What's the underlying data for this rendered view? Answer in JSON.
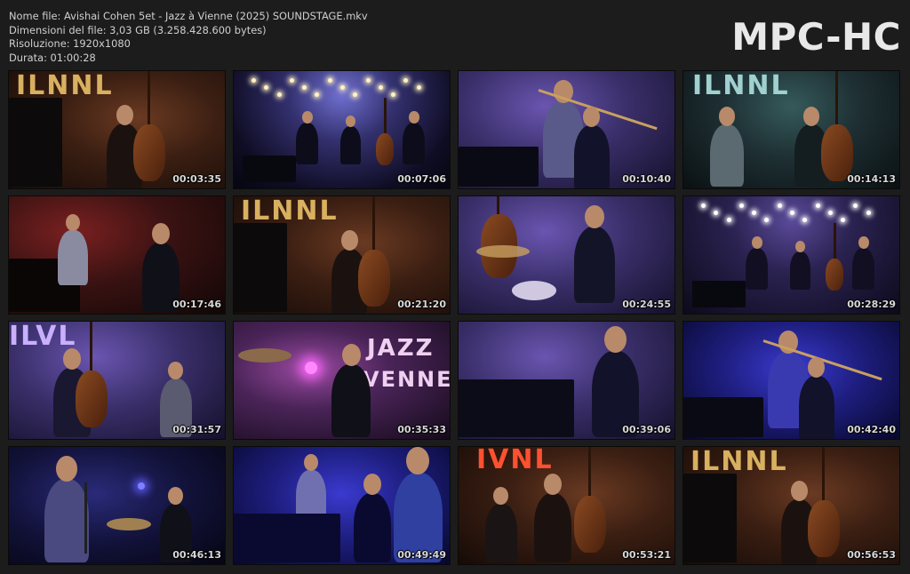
{
  "file_info": {
    "name_line": "Nome file: Avishai Cohen 5et - Jazz à Vienne (2025) SOUNDSTAGE.mkv",
    "size_line": "Dimensioni del file: 3,03 GB (3.258.428.600 bytes)",
    "resolution_line": "Risoluzione: 1920x1080",
    "duration_line": "Durata: 01:00:28"
  },
  "logo": "MPC-HC",
  "thumbnails": [
    {
      "timestamp": "00:03:35",
      "scene": "bass-solo",
      "palette": "amber"
    },
    {
      "timestamp": "00:07:06",
      "scene": "wide-stage",
      "palette": "blue-stage"
    },
    {
      "timestamp": "00:10:40",
      "scene": "trombone-piano",
      "palette": "violet"
    },
    {
      "timestamp": "00:14:13",
      "scene": "trombone-bass",
      "palette": "teal"
    },
    {
      "timestamp": "00:17:46",
      "scene": "sax-piano",
      "palette": "red"
    },
    {
      "timestamp": "00:21:20",
      "scene": "bass-solo",
      "palette": "amber"
    },
    {
      "timestamp": "00:24:55",
      "scene": "drums",
      "palette": "violet"
    },
    {
      "timestamp": "00:28:29",
      "scene": "wide-stage",
      "palette": "purple-stage"
    },
    {
      "timestamp": "00:31:57",
      "scene": "bass-sax",
      "palette": "violet"
    },
    {
      "timestamp": "00:35:33",
      "scene": "drums-sign",
      "palette": "magenta"
    },
    {
      "timestamp": "00:39:06",
      "scene": "piano-closeup",
      "palette": "violet"
    },
    {
      "timestamp": "00:42:40",
      "scene": "trombone-piano",
      "palette": "blue"
    },
    {
      "timestamp": "00:46:13",
      "scene": "clarinet-drums",
      "palette": "dark-blue"
    },
    {
      "timestamp": "00:49:49",
      "scene": "clarinet-piano",
      "palette": "blue"
    },
    {
      "timestamp": "00:53:21",
      "scene": "trio-bass",
      "palette": "amber"
    },
    {
      "timestamp": "00:56:53",
      "scene": "bass-solo",
      "palette": "amber"
    }
  ]
}
